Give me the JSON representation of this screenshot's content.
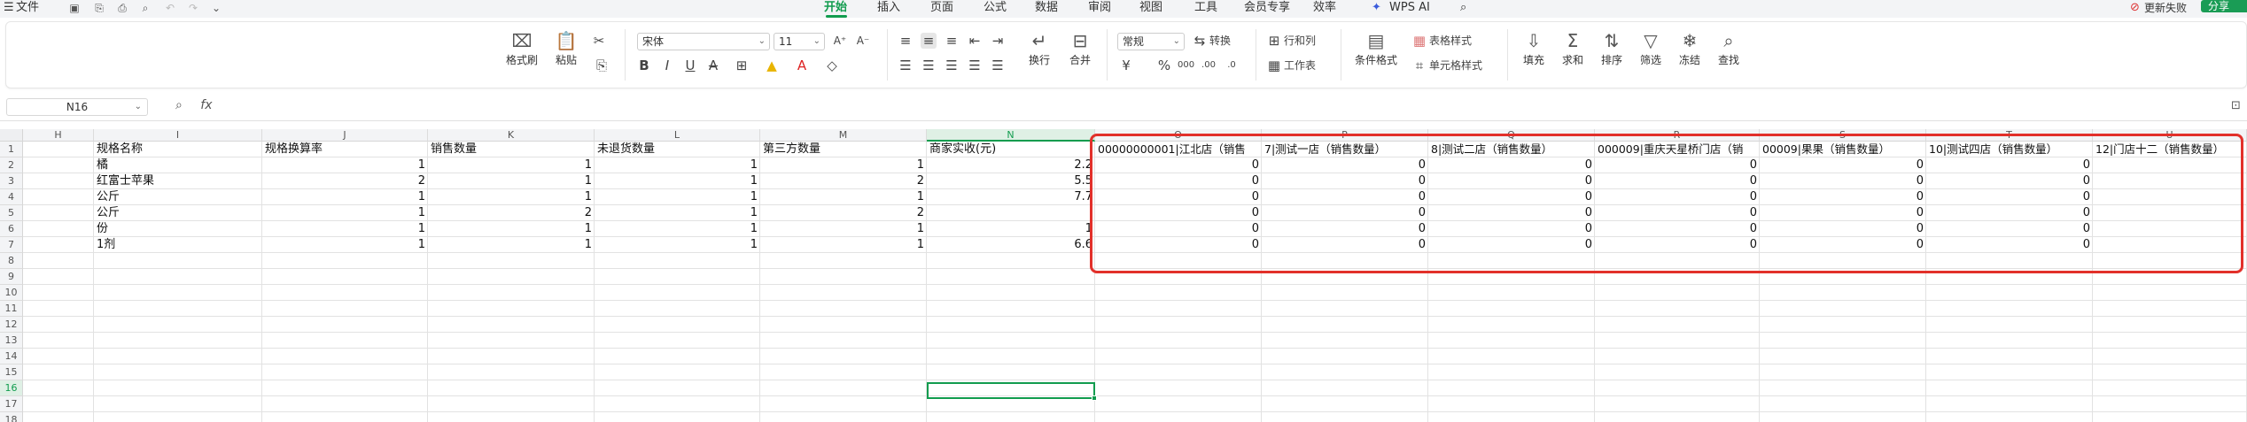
{
  "menubar": {
    "file": "文件",
    "tabs": [
      "开始",
      "插入",
      "页面",
      "公式",
      "数据",
      "审阅",
      "视图",
      "工具",
      "会员专享",
      "效率"
    ],
    "active_tab": "开始",
    "wps_ai": "WPS AI",
    "update": "更新失败",
    "share": "分享"
  },
  "ribbon": {
    "format_painter": "格式刷",
    "paste": "粘贴",
    "font_name": "宋体",
    "font_size": "11",
    "wrap": "换行",
    "merge": "合并",
    "number_format": "常规",
    "convert": "转换",
    "rows_cols": "行和列",
    "worksheet": "工作表",
    "conditional_format": "条件格式",
    "table_style": "表格样式",
    "cell_style": "单元格样式",
    "fill": "填充",
    "sum": "求和",
    "sort": "排序",
    "filter": "筛选",
    "freeze": "冻结",
    "find": "查找"
  },
  "formula_bar": {
    "name_box": "N16",
    "fx": "fx",
    "value": ""
  },
  "sheet": {
    "columns": [
      "H",
      "I",
      "J",
      "K",
      "L",
      "M",
      "N",
      "O",
      "P",
      "Q",
      "R",
      "S",
      "T",
      "U"
    ],
    "selected_column": "N",
    "selected_row": "16",
    "rows": [
      "1",
      "2",
      "3",
      "4",
      "5",
      "6",
      "7",
      "8",
      "9",
      "10",
      "11",
      "12",
      "13",
      "14",
      "15",
      "16",
      "17",
      "18"
    ],
    "header_row": [
      "规格名称",
      "规格换算率",
      "销售数量",
      "未退货数量",
      "第三方数量",
      "商家实收(元)",
      "00000000001|江北店（销售",
      "7|测试一店（销售数量）",
      "8|测试二店（销售数量）",
      "000009|重庆天星桥门店（销",
      "00009|果果（销售数量）",
      "10|测试四店（销售数量）",
      "12|门店十二（销售数量）"
    ],
    "data_rows": [
      {
        "name": "橘",
        "rate": "1",
        "sales": "1",
        "unreturned": "1",
        "third": "1",
        "income": "2.2",
        "stores": [
          "0",
          "0",
          "0",
          "0",
          "0",
          "0"
        ]
      },
      {
        "name": "红富士苹果",
        "rate": "2",
        "sales": "1",
        "unreturned": "1",
        "third": "2",
        "income": "5.5",
        "stores": [
          "0",
          "0",
          "0",
          "0",
          "0",
          "0"
        ]
      },
      {
        "name": "公斤",
        "rate": "1",
        "sales": "1",
        "unreturned": "1",
        "third": "1",
        "income": "7.7",
        "stores": [
          "0",
          "0",
          "0",
          "0",
          "0",
          "0"
        ]
      },
      {
        "name": "公斤",
        "rate": "1",
        "sales": "2",
        "unreturned": "1",
        "third": "2",
        "income": "",
        "stores": [
          "0",
          "0",
          "0",
          "0",
          "0",
          "0"
        ]
      },
      {
        "name": "份",
        "rate": "1",
        "sales": "1",
        "unreturned": "1",
        "third": "1",
        "income": "1",
        "stores": [
          "0",
          "0",
          "0",
          "0",
          "0",
          "0"
        ]
      },
      {
        "name": "1剂",
        "rate": "1",
        "sales": "1",
        "unreturned": "1",
        "third": "1",
        "income": "6.6",
        "stores": [
          "0",
          "0",
          "0",
          "0",
          "0",
          "0"
        ]
      }
    ]
  }
}
